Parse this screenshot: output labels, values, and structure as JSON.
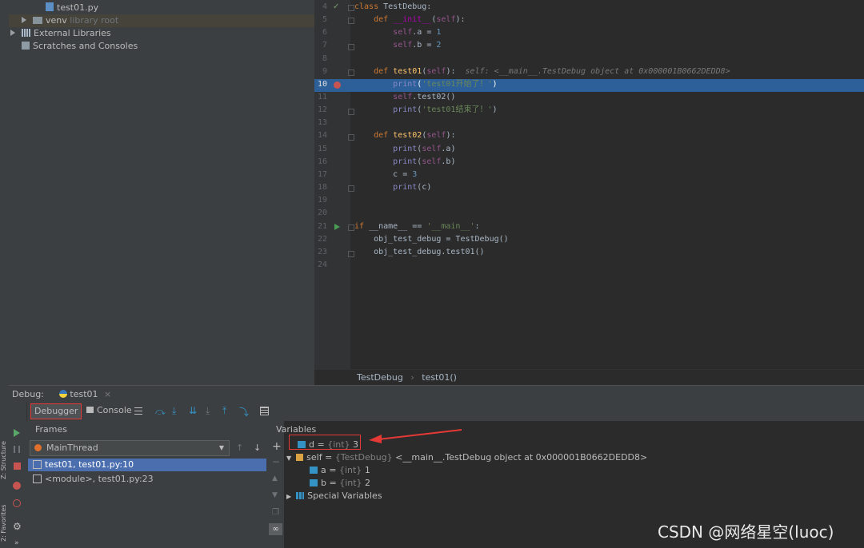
{
  "project_tree": {
    "file": "test01.py",
    "venv": {
      "name": "venv",
      "hint": "library root"
    },
    "external_libraries": "External Libraries",
    "scratches": "Scratches and Consoles"
  },
  "editor": {
    "lines": [
      {
        "n": "4"
      },
      {
        "n": "5"
      },
      {
        "n": "6"
      },
      {
        "n": "7"
      },
      {
        "n": "8"
      },
      {
        "n": "9"
      },
      {
        "n": "10"
      },
      {
        "n": "11"
      },
      {
        "n": "12"
      },
      {
        "n": "13"
      },
      {
        "n": "14"
      },
      {
        "n": "15"
      },
      {
        "n": "16"
      },
      {
        "n": "17"
      },
      {
        "n": "18"
      },
      {
        "n": "19"
      },
      {
        "n": "20"
      },
      {
        "n": "21"
      },
      {
        "n": "22"
      },
      {
        "n": "23"
      },
      {
        "n": "24"
      }
    ],
    "inline_hint": "self: <__main__.TestDebug object at 0x000001B0662DEDD8>",
    "current_line": "10",
    "breadcrumb": [
      "TestDebug",
      "test01()"
    ]
  },
  "debug": {
    "label": "Debug:",
    "run_tab": "test01",
    "tabs": {
      "debugger": "Debugger",
      "console": "Console"
    },
    "frames_title": "Frames",
    "thread": "MainThread",
    "frames": [
      "test01, test01.py:10",
      "<module>, test01.py:23"
    ],
    "variables_title": "Variables",
    "variables": [
      {
        "name": "d",
        "type": "{int}",
        "value": "3"
      },
      {
        "name": "self",
        "type": "{TestDebug}",
        "value": "<__main__.TestDebug object at 0x000001B0662DEDD8>"
      },
      {
        "name": "a",
        "type": "{int}",
        "value": "1"
      },
      {
        "name": "b",
        "type": "{int}",
        "value": "2"
      },
      {
        "name": "Special Variables"
      }
    ]
  },
  "side_tabs": {
    "structure": "Z: Structure",
    "favorites": "2: Favorites"
  },
  "watermark": "CSDN @网络星空(luoc)",
  "colors": {
    "highlight": "#2d6099",
    "breakpoint": "#c75450",
    "annotation": "#e53935"
  }
}
